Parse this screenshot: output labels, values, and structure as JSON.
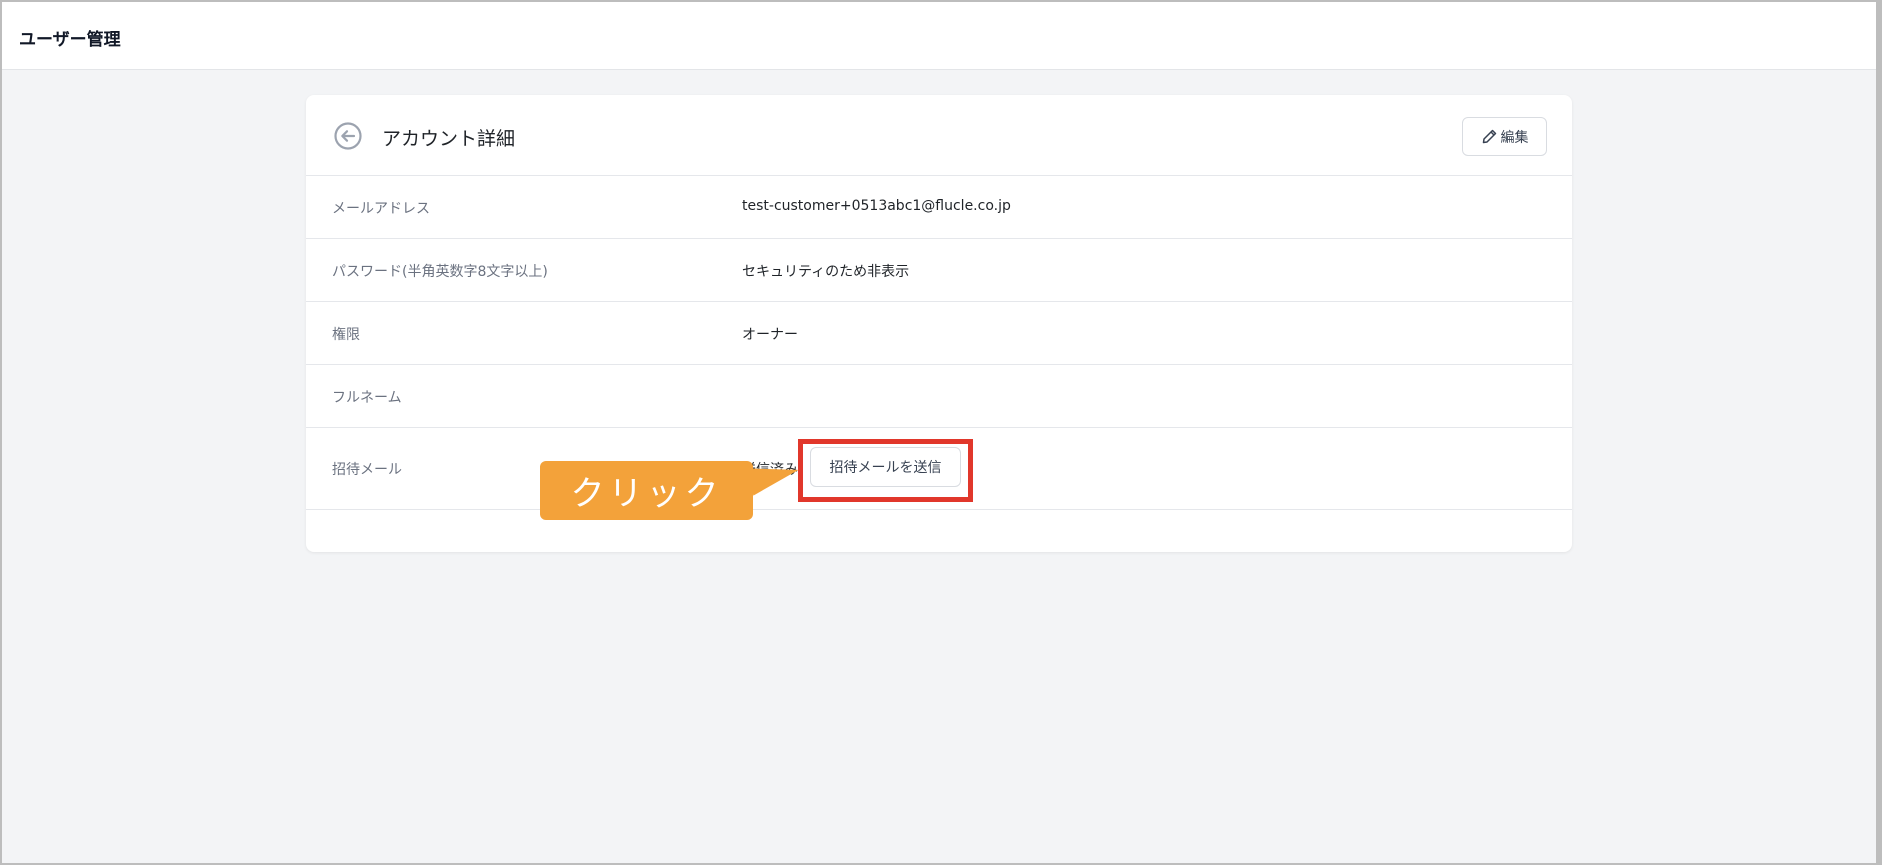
{
  "app": {
    "title": "ユーザー管理"
  },
  "card": {
    "title": "アカウント詳細",
    "edit_label": "編集"
  },
  "fields": [
    {
      "label": "メールアドレス",
      "value": "test-customer+0513abc1@flucle.co.jp"
    },
    {
      "label": "パスワード(半角英数字8文字以上)",
      "value": "セキュリティのため非表示"
    },
    {
      "label": "権限",
      "value": "オーナー"
    },
    {
      "label": "フルネーム",
      "value": ""
    },
    {
      "label": "招待メール",
      "value": "送信済み",
      "button_label": "招待メールを送信"
    }
  ],
  "annotation": {
    "callout_text": "クリック",
    "callout_color": "#f3a23a",
    "highlight_color": "#e1372b"
  },
  "icons": {
    "back": "arrow-left-circle-icon",
    "edit": "pencil-icon"
  }
}
